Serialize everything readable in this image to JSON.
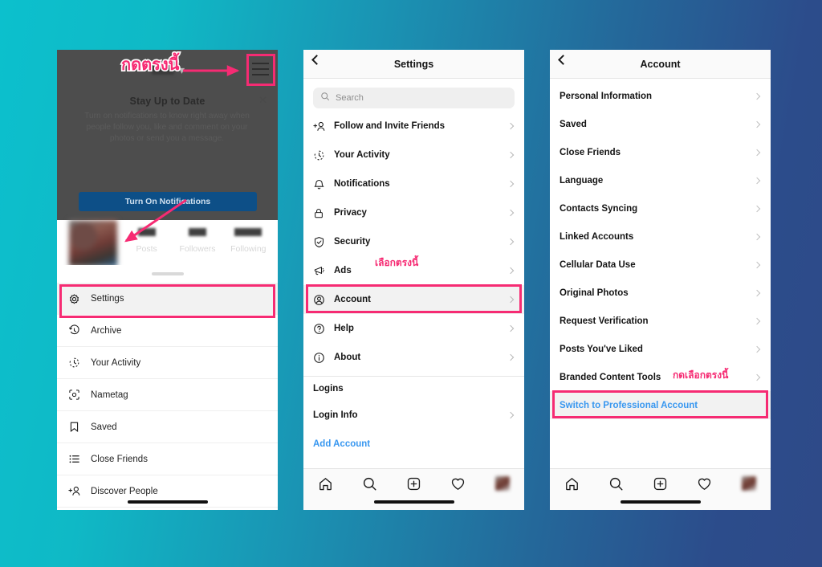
{
  "background": {
    "from": "#0cc0cd",
    "to": "#2e4a88"
  },
  "accent": "#f62b73",
  "link_color": "#3897f0",
  "phone1": {
    "banner": {
      "title": "Stay Up to Date",
      "body": "Turn on notifications to know right away when people follow you, like and comment on your photos or send you a message.",
      "button": "Turn On Notifications",
      "close_icon": "close-icon"
    },
    "stats": [
      {
        "label": "Posts"
      },
      {
        "label": "Followers"
      },
      {
        "label": "Following"
      }
    ],
    "menu": [
      {
        "label": "Settings",
        "icon": "gear-icon",
        "highlighted": true
      },
      {
        "label": "Archive",
        "icon": "archive-clock-icon"
      },
      {
        "label": "Your Activity",
        "icon": "activity-clock-icon"
      },
      {
        "label": "Nametag",
        "icon": "nametag-icon"
      },
      {
        "label": "Saved",
        "icon": "bookmark-icon"
      },
      {
        "label": "Close Friends",
        "icon": "list-icon"
      },
      {
        "label": "Discover People",
        "icon": "add-person-icon"
      }
    ],
    "hamburger_icon": "hamburger-menu-icon",
    "chevron_icon": "chevron-down-icon"
  },
  "phone2": {
    "title": "Settings",
    "back_icon": "back-chevron-icon",
    "search": {
      "placeholder": "Search",
      "icon": "search-icon"
    },
    "items": [
      {
        "label": "Follow and Invite Friends",
        "icon": "add-person-icon"
      },
      {
        "label": "Your Activity",
        "icon": "activity-clock-icon"
      },
      {
        "label": "Notifications",
        "icon": "bell-icon"
      },
      {
        "label": "Privacy",
        "icon": "lock-icon"
      },
      {
        "label": "Security",
        "icon": "shield-check-icon"
      },
      {
        "label": "Ads",
        "icon": "megaphone-icon"
      },
      {
        "label": "Account",
        "icon": "account-circle-icon",
        "highlighted": true
      },
      {
        "label": "Help",
        "icon": "help-circle-icon"
      },
      {
        "label": "About",
        "icon": "info-circle-icon"
      }
    ],
    "logins_header": "Logins",
    "login_info": "Login Info",
    "add_account": "Add Account",
    "tabs": [
      {
        "icon": "home-icon"
      },
      {
        "icon": "search-icon"
      },
      {
        "icon": "add-post-icon"
      },
      {
        "icon": "heart-icon"
      },
      {
        "icon": "profile-avatar"
      }
    ]
  },
  "phone3": {
    "title": "Account",
    "back_icon": "back-chevron-icon",
    "items": [
      {
        "label": "Personal Information"
      },
      {
        "label": "Saved"
      },
      {
        "label": "Close Friends"
      },
      {
        "label": "Language"
      },
      {
        "label": "Contacts Syncing"
      },
      {
        "label": "Linked Accounts"
      },
      {
        "label": "Cellular Data Use"
      },
      {
        "label": "Original Photos"
      },
      {
        "label": "Request Verification"
      },
      {
        "label": "Posts You've Liked"
      },
      {
        "label": "Branded Content Tools"
      }
    ],
    "switch_link": "Switch to Professional Account",
    "tabs": [
      {
        "icon": "home-icon"
      },
      {
        "icon": "search-icon"
      },
      {
        "icon": "add-post-icon"
      },
      {
        "icon": "heart-icon"
      },
      {
        "icon": "profile-avatar"
      }
    ]
  },
  "annotations": {
    "a1": "กดตรงนี้",
    "a2": "เลือกตรงนี้",
    "a3": "กดเลือกตรงนี้"
  }
}
